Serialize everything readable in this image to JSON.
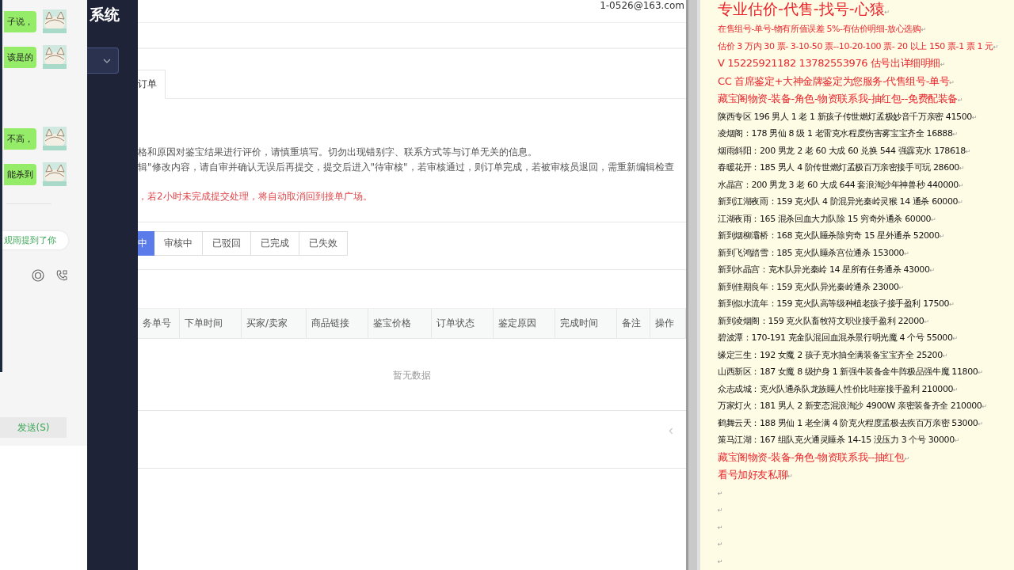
{
  "chat": {
    "messages": [
      {
        "text": "子说，"
      },
      {
        "text": "该是的"
      },
      {
        "text": "不高，"
      },
      {
        "text": "能杀到"
      }
    ],
    "mention": "观雨提到了你",
    "send_button": "发送(S)"
  },
  "sidebar": {
    "title": "系统"
  },
  "main": {
    "account": "1-0526@163.com",
    "tab": {
      "label": "订单",
      "selected": true
    },
    "notices": [
      {
        "kind": "info",
        "text": "格和原因对鉴宝结果进行评价，请慎重填写。切勿出现错别字、联系方式等与订单无关的信息。"
      },
      {
        "kind": "info",
        "text": "辑\"修改内容，请自审并确认无误后再提交，提交后进入\"待审核\"，若审核通过，则订单完成，若被审核员退回，需重新编辑检查"
      },
      {
        "kind": "warning",
        "text": "，若2小时未完成提交处理，将自动取消回到接单广场。"
      }
    ],
    "status_tabs": [
      {
        "label": "中",
        "selected": true
      },
      {
        "label": "审核中",
        "selected": false
      },
      {
        "label": "已驳回",
        "selected": false
      },
      {
        "label": "已完成",
        "selected": false
      },
      {
        "label": "已失效",
        "selected": false
      }
    ],
    "table": {
      "columns": [
        "务单号",
        "下单时间",
        "买家/卖家",
        "商品链接",
        "鉴宝价格",
        "订单状态",
        "鉴定原因",
        "完成时间",
        "备注",
        "操作"
      ],
      "empty_text": "暂无数据"
    },
    "pager": "‹"
  },
  "document": {
    "lines": [
      {
        "kind": "heading",
        "text": "专业估价-代售-找号-心猿",
        "mark": "↵"
      },
      {
        "kind": "red",
        "text": "在售组号-单号-物有所值误差 5%-有估价明细-放心选购",
        "mark": "↵"
      },
      {
        "kind": "red",
        "text": "估价 3 万内 30 票- 3-10-50 票--10-20-100 票- 20 以上 150 票-1 票 1 元",
        "mark": "↵"
      },
      {
        "kind": "red-large",
        "text": "V 15225921182      13782553976    估号出详细明细",
        "mark": "↵"
      },
      {
        "kind": "red-large",
        "text": "CC 首席鉴定+大神金牌鉴定为您服务-代售组号-单号",
        "mark": "↵"
      },
      {
        "kind": "red-large",
        "text": "藏宝阁物资-装备-角色-物资联系我-抽红包--免费配装备",
        "mark": "↵"
      },
      {
        "kind": "normal",
        "text": "陕西专区 196 男人 1 老 1 新孩子传世燃灯孟极妙音千万亲密 41500",
        "mark": "↵"
      },
      {
        "kind": "normal",
        "text": "凌烟阁：178 男仙 8 级 1 老雷克水程度伤害雾宝宝齐全 16888",
        "mark": "↵"
      },
      {
        "kind": "normal",
        "text": "烟雨斜阳：200 男龙 2 老 60 大成 60 兑换 544 强霹克水 178618",
        "mark": "↵"
      },
      {
        "kind": "normal",
        "text": "春暖花开：185 男人 4 阶传世燃灯孟极百万亲密接手可玩 28600",
        "mark": "↵"
      },
      {
        "kind": "normal",
        "text": "水晶宫：200 男龙 3 老 60 大成 644 套浪淘沙年神兽秒 440000",
        "mark": "↵"
      },
      {
        "kind": "normal",
        "text": "新到江湖夜雨：159 克火队 4 阶混异光秦岭灵猴 14 通杀 60000",
        "mark": "↵"
      },
      {
        "kind": "normal",
        "text": "江湖夜雨：165 混杀回血大力队除 15 穷奇外通杀 60000",
        "mark": "↵"
      },
      {
        "kind": "normal",
        "text": "新到烟柳灞桥：168 克火队睡杀除穷奇 15 星外通杀 52000",
        "mark": "↵"
      },
      {
        "kind": "normal",
        "text": "新到飞鸿踏雪：185 克火队睡杀宫位通杀 153000",
        "mark": "↵"
      },
      {
        "kind": "normal",
        "text": "新到水晶宫：克木队异光秦岭 14 星所有任务通杀 43000",
        "mark": "↵"
      },
      {
        "kind": "normal",
        "text": "新到佳期良年：159 克火队异光秦岭通杀 23000",
        "mark": "↵"
      },
      {
        "kind": "normal",
        "text": "新到似水流年：159 克火队高等级种植老孩子接手盈利 17500",
        "mark": "↵"
      },
      {
        "kind": "normal",
        "text": "新到凌烟阁：159 克火队畜牧符文职业接手盈利 22000",
        "mark": "↵"
      },
      {
        "kind": "normal",
        "text": "碧波潭：170-191 克金队混回血混杀景行明光魔 4 个号 55000",
        "mark": "↵"
      },
      {
        "kind": "normal",
        "text": "缘定三生：192 女魔 2 孩子克水抽全满装备宝宝齐全 25200",
        "mark": "↵"
      },
      {
        "kind": "normal",
        "text": "山西新区：187 女魔 8 级护身 1 新强牛装备金牛阵极品强牛魔 11800",
        "mark": "↵"
      },
      {
        "kind": "normal",
        "text": "众志成城：克火队通杀队龙族睡人性价比哇塞接手盈利 210000",
        "mark": "↵"
      },
      {
        "kind": "normal",
        "text": "万家灯火：181 男人 2 新变态混浪淘沙 4900W 亲密装备齐全 210000",
        "mark": "↵"
      },
      {
        "kind": "normal",
        "text": "鹤舞云天：188 男仙 1 老全满 4 阶克火程度孟极去疾百万亲密 53000",
        "mark": "↵"
      },
      {
        "kind": "normal",
        "text": "策马江湖：167 组队克火通灵睡杀 14-15 没压力 3 个号 30000",
        "mark": "↵"
      },
      {
        "kind": "red-large",
        "text": "藏宝阁物资-装备-角色-物资联系我--抽红包",
        "mark": "↵"
      },
      {
        "kind": "red-large",
        "text": "看号加好友私聊",
        "mark": "↵"
      },
      {
        "kind": "blank",
        "mark": "↵"
      },
      {
        "kind": "blank",
        "mark": "↵"
      },
      {
        "kind": "blank",
        "mark": "↵"
      },
      {
        "kind": "blank",
        "mark": "↵"
      },
      {
        "kind": "blank",
        "mark": "↵"
      }
    ]
  }
}
